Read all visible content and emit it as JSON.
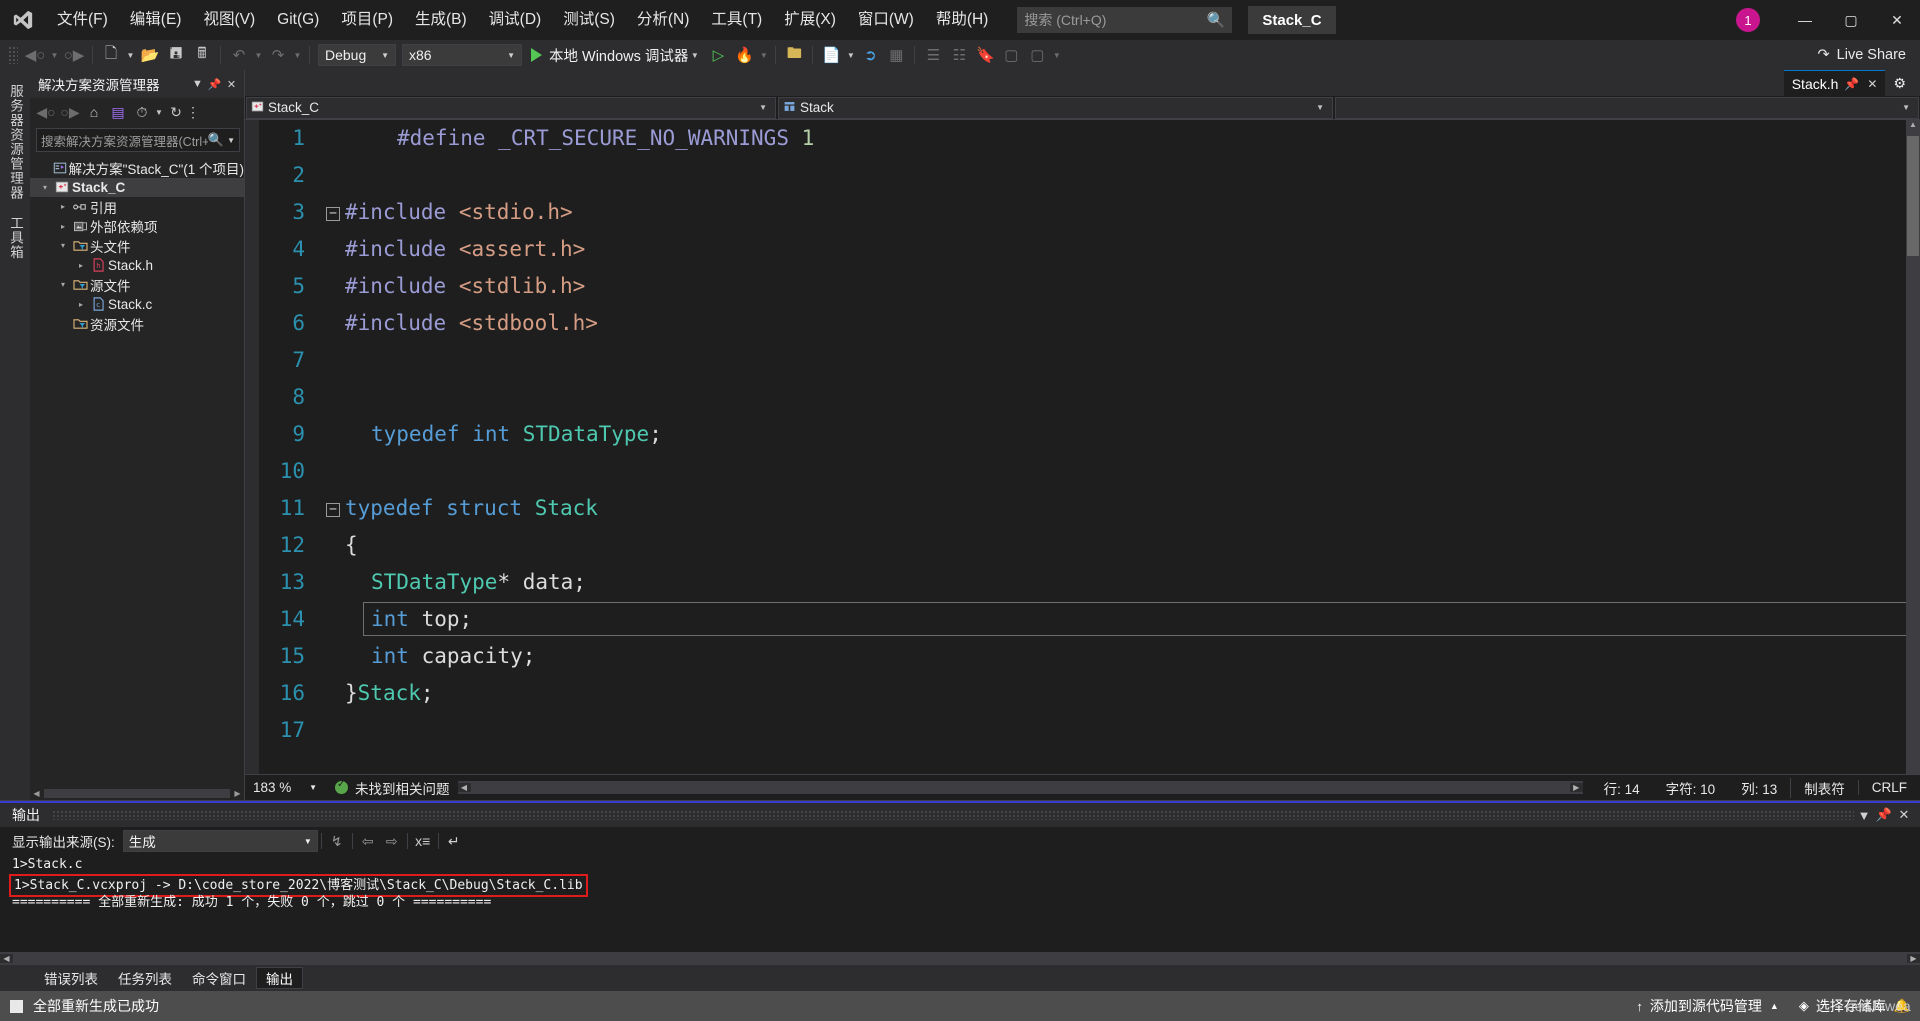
{
  "titlebar": {
    "logo_icon": "visual-studio-logo",
    "menus": [
      "文件(F)",
      "编辑(E)",
      "视图(V)",
      "Git(G)",
      "项目(P)",
      "生成(B)",
      "调试(D)",
      "测试(S)",
      "分析(N)",
      "工具(T)",
      "扩展(X)",
      "窗口(W)",
      "帮助(H)"
    ],
    "search_placeholder": "搜索 (Ctrl+Q)",
    "search_icon": "magnifier-icon",
    "project_chip": "Stack_C",
    "notification_count": "1",
    "minimize": "—",
    "maximize": "▢",
    "close": "✕"
  },
  "toolbar": {
    "nav_back_icon": "arrow-back-icon",
    "nav_forward_icon": "arrow-forward-icon",
    "new_item_icon": "new-item-icon",
    "open_icon": "open-folder-icon",
    "save_icon": "save-icon",
    "save_all_icon": "save-all-icon",
    "undo_icon": "undo-icon",
    "redo_icon": "redo-icon",
    "config_value": "Debug",
    "platform_value": "x86",
    "run_label": "本地 Windows 调试器",
    "run_icon": "play-icon",
    "attach_icon": "play-outline-icon",
    "hot_reload_icon": "flame-icon",
    "show_all_files_icon": "show-all-files-icon",
    "properties_icon": "properties-icon",
    "pointer_icon": "pointer-icon",
    "columns_icon": "columns-icon",
    "bookmark_icon": "bookmark-icon",
    "live_share": "Live Share",
    "live_share_icon": "live-share-icon"
  },
  "leftrail": {
    "tabs": [
      "服务器资源管理器",
      "工具箱"
    ]
  },
  "solution": {
    "title": "解决方案资源管理器",
    "dropdown_icon": "chevron-down-icon",
    "pin_icon": "pin-icon",
    "close_icon": "close-icon",
    "toolbar_icons": [
      "arrow-back-icon",
      "arrow-forward-icon",
      "home-icon",
      "vs-pending-changes-icon",
      "history-icon",
      "refresh-icon",
      "collapse-all-icon"
    ],
    "search_placeholder": "搜索解决方案资源管理器(Ctrl+;)",
    "search_icon": "magnifier-icon",
    "tree": [
      {
        "label": "解决方案\"Stack_C\"(1 个项目)",
        "indent": 0,
        "twisty": "",
        "icon": "solution-icon",
        "bold": false,
        "selected": false
      },
      {
        "label": "Stack_C",
        "indent": 1,
        "twisty": "▾",
        "icon": "cpp-project-icon",
        "bold": true,
        "selected": true
      },
      {
        "label": "引用",
        "indent": 2,
        "twisty": "▸",
        "icon": "references-icon",
        "bold": false,
        "selected": false
      },
      {
        "label": "外部依赖项",
        "indent": 2,
        "twisty": "▸",
        "icon": "external-deps-icon",
        "bold": false,
        "selected": false
      },
      {
        "label": "头文件",
        "indent": 2,
        "twisty": "▾",
        "icon": "filter-folder-icon",
        "bold": false,
        "selected": false
      },
      {
        "label": "Stack.h",
        "indent": 3,
        "twisty": "▸",
        "icon": "header-file-icon",
        "bold": false,
        "selected": false
      },
      {
        "label": "源文件",
        "indent": 2,
        "twisty": "▾",
        "icon": "filter-folder-icon",
        "bold": false,
        "selected": false
      },
      {
        "label": "Stack.c",
        "indent": 3,
        "twisty": "▸",
        "icon": "c-file-icon",
        "bold": false,
        "selected": false
      },
      {
        "label": "资源文件",
        "indent": 2,
        "twisty": "",
        "icon": "filter-folder-icon",
        "bold": false,
        "selected": false
      }
    ]
  },
  "editor": {
    "doc_tab": "Stack.h",
    "doc_tab_pin_icon": "pin-icon",
    "doc_tab_close_icon": "close-icon",
    "doc_tab_menu_icon": "gear-icon",
    "nav_project": "Stack_C",
    "nav_project_icon": "cpp-project-icon",
    "nav_scope": "Stack",
    "nav_scope_icon": "struct-icon",
    "nav_member": "",
    "lines": [
      {
        "n": "1",
        "fold": "",
        "guide": false,
        "indent": 2,
        "tokens": [
          {
            "t": "#define",
            "c": "pp"
          },
          {
            "t": " ",
            "c": "pl"
          },
          {
            "t": "_CRT_SECURE_NO_WARNINGS",
            "c": "pp"
          },
          {
            "t": " ",
            "c": "pl"
          },
          {
            "t": "1",
            "c": "num"
          }
        ]
      },
      {
        "n": "2",
        "fold": "",
        "guide": false,
        "indent": 0,
        "tokens": []
      },
      {
        "n": "3",
        "fold": "−",
        "guide": false,
        "indent": 0,
        "tokens": [
          {
            "t": "#include",
            "c": "pp"
          },
          {
            "t": " ",
            "c": "pl"
          },
          {
            "t": "<stdio.h>",
            "c": "str"
          }
        ]
      },
      {
        "n": "4",
        "fold": "",
        "guide": true,
        "indent": 0,
        "tokens": [
          {
            "t": "#include",
            "c": "pp"
          },
          {
            "t": " ",
            "c": "pl"
          },
          {
            "t": "<assert.h>",
            "c": "str"
          }
        ]
      },
      {
        "n": "5",
        "fold": "",
        "guide": true,
        "indent": 0,
        "tokens": [
          {
            "t": "#include",
            "c": "pp"
          },
          {
            "t": " ",
            "c": "pl"
          },
          {
            "t": "<stdlib.h>",
            "c": "str"
          }
        ]
      },
      {
        "n": "6",
        "fold": "",
        "guide": true,
        "indent": 0,
        "tokens": [
          {
            "t": "#include",
            "c": "pp"
          },
          {
            "t": " ",
            "c": "pl"
          },
          {
            "t": "<stdbool.h>",
            "c": "str"
          }
        ]
      },
      {
        "n": "7",
        "fold": "",
        "guide": false,
        "indent": 0,
        "tokens": []
      },
      {
        "n": "8",
        "fold": "",
        "guide": false,
        "indent": 0,
        "tokens": []
      },
      {
        "n": "9",
        "fold": "",
        "guide": false,
        "indent": 1,
        "tokens": [
          {
            "t": "typedef",
            "c": "kw"
          },
          {
            "t": " ",
            "c": "pl"
          },
          {
            "t": "int",
            "c": "kw"
          },
          {
            "t": " ",
            "c": "pl"
          },
          {
            "t": "STDataType",
            "c": "type"
          },
          {
            "t": ";",
            "c": "pl"
          }
        ]
      },
      {
        "n": "10",
        "fold": "",
        "guide": false,
        "indent": 0,
        "tokens": []
      },
      {
        "n": "11",
        "fold": "−",
        "guide": false,
        "indent": 0,
        "tokens": [
          {
            "t": "typedef",
            "c": "kw"
          },
          {
            "t": " ",
            "c": "pl"
          },
          {
            "t": "struct",
            "c": "kw"
          },
          {
            "t": " ",
            "c": "pl"
          },
          {
            "t": "Stack",
            "c": "type"
          }
        ]
      },
      {
        "n": "12",
        "fold": "",
        "guide": true,
        "indent": 0,
        "tokens": [
          {
            "t": "{",
            "c": "pl"
          }
        ]
      },
      {
        "n": "13",
        "fold": "",
        "guide": true,
        "indent": 1,
        "tokens": [
          {
            "t": "STDataType",
            "c": "type"
          },
          {
            "t": "* ",
            "c": "pl"
          },
          {
            "t": "data;",
            "c": "pl"
          }
        ]
      },
      {
        "n": "14",
        "fold": "",
        "guide": true,
        "indent": 1,
        "tokens": [
          {
            "t": "int",
            "c": "kw"
          },
          {
            "t": " top;",
            "c": "pl"
          }
        ]
      },
      {
        "n": "15",
        "fold": "",
        "guide": true,
        "indent": 1,
        "tokens": [
          {
            "t": "int",
            "c": "kw"
          },
          {
            "t": " capacity;",
            "c": "pl"
          }
        ]
      },
      {
        "n": "16",
        "fold": "",
        "guide": true,
        "indent": 0,
        "tokens": [
          {
            "t": "}",
            "c": "pl"
          },
          {
            "t": "Stack",
            "c": "type"
          },
          {
            "t": ";",
            "c": "pl"
          }
        ]
      },
      {
        "n": "17",
        "fold": "",
        "guide": false,
        "indent": 0,
        "tokens": []
      }
    ],
    "current_line": "14",
    "status": {
      "zoom": "183 %",
      "issues": "未找到相关问题",
      "issues_icon": "check-circle-icon",
      "line": "行: 14",
      "char": "字符: 10",
      "col": "列: 13",
      "tabs_mode": "制表符",
      "eol": "CRLF"
    }
  },
  "output": {
    "title": "输出",
    "dropdown_icon": "chevron-down-icon",
    "pin_icon": "pin-icon",
    "close_icon": "close-icon",
    "source_label": "显示输出来源(S):",
    "source_value": "生成",
    "toolbar_icons": [
      "goto-message-icon",
      "prev-message-icon",
      "next-message-icon",
      "clear-all-icon",
      "word-wrap-icon"
    ],
    "lines": [
      {
        "text": "1>Stack.c",
        "highlight": false
      },
      {
        "text": "1>Stack_C.vcxproj -> D:\\code_store_2022\\博客测试\\Stack_C\\Debug\\Stack_C.lib",
        "highlight": true
      },
      {
        "text": "========== 全部重新生成: 成功 1 个，失败 0 个，跳过 0 个 ==========",
        "highlight": false
      }
    ]
  },
  "bottom_tabs": {
    "tabs": [
      "错误列表",
      "任务列表",
      "命令窗口",
      "输出"
    ],
    "active": "输出"
  },
  "statusbar": {
    "message": "全部重新生成已成功",
    "source_control": "添加到源代码管理",
    "source_control_icon": "arrow-up-icon",
    "source_control_caret": "▲",
    "repo": "选择存储库",
    "repo_icon": "git-repo-icon",
    "watermark": "aeaJawea",
    "bell_icon": "bell-icon"
  },
  "colors": {
    "accent": "#007acc",
    "status_bar": "#4d4d4d",
    "highlight_red": "#e01b1b",
    "badge_pink": "#c9168f",
    "success_green": "#57a64a"
  }
}
